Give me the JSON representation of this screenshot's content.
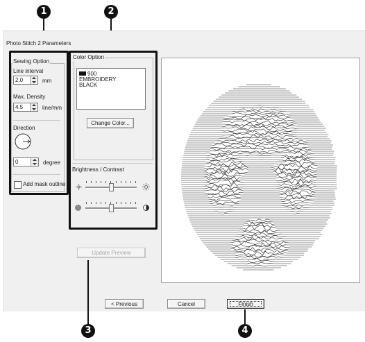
{
  "window": {
    "title": "Photo Stitch 2 Parameters"
  },
  "callouts": {
    "c1": "1",
    "c2": "2",
    "c3": "3",
    "c4": "4"
  },
  "sewing": {
    "group_label": "Sewing Option",
    "line_interval_label": "Line interval",
    "line_interval_value": "2.0",
    "line_interval_unit": "mm",
    "max_density_label": "Max. Density",
    "max_density_value": "4.5",
    "max_density_unit": "line/mm",
    "direction_label": "Direction",
    "degree_value": "0",
    "degree_unit": "degree",
    "mask_outline_label": "Add mask outline",
    "mask_outline_checked": false
  },
  "color": {
    "group_label": "Color Option",
    "list_items": [
      {
        "swatch": "#111111",
        "text": "900"
      },
      {
        "text": "EMBROIDERY"
      },
      {
        "text": "BLACK"
      }
    ],
    "change_color_label": "Change Color..."
  },
  "brightness": {
    "label": "Brightness / Contrast",
    "brightness_level": 0.5,
    "contrast_level": 0.5
  },
  "buttons": {
    "update_preview": "Update Preview",
    "previous": "< Previous",
    "cancel": "Cancel",
    "finish": "Finish"
  },
  "colors": {
    "dialog_bg": "#f0f0f0",
    "highlight": "#111111",
    "preview_bg": "#ffffff"
  },
  "icons": [
    "direction-dial-icon",
    "brightness-low-icon",
    "brightness-high-icon",
    "contrast-low-icon",
    "contrast-high-icon"
  ]
}
